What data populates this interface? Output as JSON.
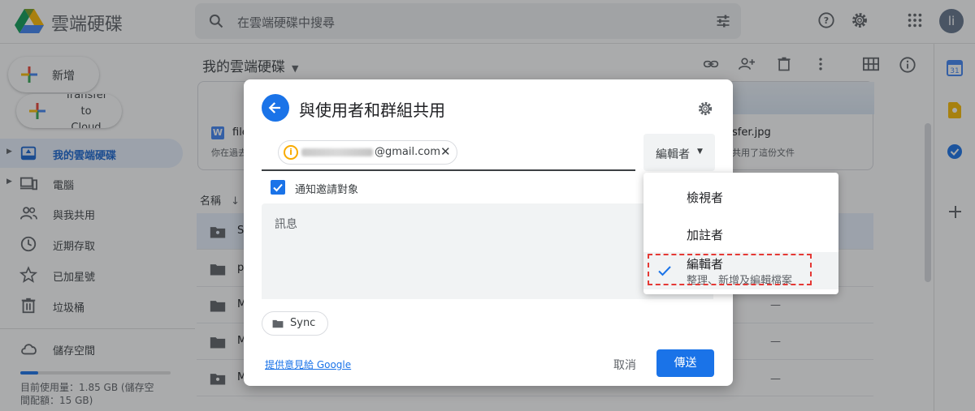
{
  "app": {
    "name": "雲端硬碟",
    "search_placeholder": "在雲端硬碟中搜尋",
    "avatar_initial": "li"
  },
  "sidebar": {
    "new_label": "新增",
    "transfer_label": "Transfer\nto\nCloud",
    "items": [
      {
        "label": "我的雲端硬碟",
        "icon": "my-drive-icon",
        "active": true
      },
      {
        "label": "電腦",
        "icon": "computers-icon"
      },
      {
        "label": "與我共用",
        "icon": "shared-with-me-icon"
      },
      {
        "label": "近期存取",
        "icon": "recent-icon"
      },
      {
        "label": "已加星號",
        "icon": "starred-icon"
      },
      {
        "label": "垃圾桶",
        "icon": "trash-icon"
      },
      {
        "label": "儲存空間",
        "icon": "cloud-storage-icon"
      }
    ],
    "storage_text": "目前使用量：1.85 GB (儲存空間配額：15 GB)",
    "storage_used_fraction": 0.12
  },
  "main": {
    "title": "我的雲端硬碟",
    "cards": [
      {
        "name": "file",
        "subtitle": "你在過去"
      },
      {
        "name": "sfer.jpg",
        "subtitle": "共用了這份文件"
      }
    ],
    "column_header": "名稱",
    "rows": [
      {
        "name": "S",
        "selected": true
      },
      {
        "name": "p"
      },
      {
        "name": "M"
      },
      {
        "name": "M"
      },
      {
        "name": "M"
      }
    ],
    "dash": "—"
  },
  "dialog": {
    "title": "與使用者和群組共用",
    "recipient_email": "@gmail.com",
    "role_label": "編輯者",
    "notify_label": "通知邀請對象",
    "message_placeholder": "訊息",
    "folder_chip": "Sync",
    "feedback_link": "提供意見給 Google",
    "cancel_label": "取消",
    "send_label": "傳送"
  },
  "role_menu": {
    "items": [
      {
        "label": "檢視者"
      },
      {
        "label": "加註者"
      },
      {
        "label": "編輯者",
        "description": "整理、新增及編輯檔案",
        "checked": true
      }
    ]
  },
  "colors": {
    "accent": "#1a73e8",
    "highlight": "#e53935"
  }
}
